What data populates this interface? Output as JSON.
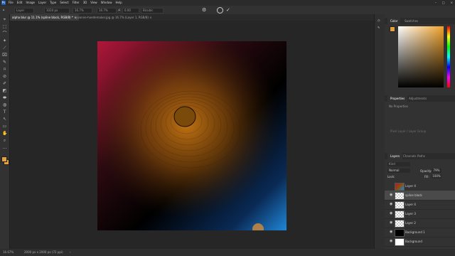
{
  "app": {
    "logo_text": "Ps"
  },
  "menu": [
    "File",
    "Edit",
    "Image",
    "Layer",
    "Type",
    "Select",
    "Filter",
    "3D",
    "View",
    "Window",
    "Help"
  ],
  "window_controls": [
    "–",
    "□",
    "×"
  ],
  "options_bar": {
    "mode": "Layer",
    "width": "1024 px",
    "height_pct": "16.7%",
    "w_pct": "16.7%",
    "x_value": "0.00",
    "angle_label": "∠",
    "interp": "Bicubic"
  },
  "tabs": [
    {
      "label": "alpha blur @ 11.1% (spline black, RGB/8) *",
      "close": "×"
    },
    {
      "label": "yvonne-hoedemaker.jpg @ 16.7% (Layer 1, RGB/8)",
      "close": "×"
    }
  ],
  "tools": [
    "⌖",
    "⬚",
    "⌒",
    "✦",
    "⟋",
    "⌧",
    "✎",
    "⌑",
    "⊘",
    "✐",
    "◩",
    "⬬",
    "◍",
    "T",
    "↖",
    "▭",
    "✋",
    "⌕",
    "…"
  ],
  "colors": {
    "foreground": "#e4a03a",
    "background": "#e4a03a"
  },
  "canvas": {
    "image": "alpha blur artwork"
  },
  "color_panel": {
    "tabs": [
      "Color",
      "Swatches"
    ]
  },
  "properties_panel": {
    "tabs": [
      "Properties",
      "Adjustments"
    ],
    "empty_text": "No Properties",
    "hint_text": "Pixel Layer / Layer Group"
  },
  "layers_panel": {
    "tabs": [
      "Layers",
      "Channels",
      "Paths"
    ],
    "kind_label": "Kind",
    "blend_mode": "Normal",
    "opacity_label": "Opacity:",
    "opacity_value": "79%",
    "lock_label": "Lock:",
    "fill_label": "Fill:",
    "fill_value": "100%",
    "layers": [
      {
        "name": "Layer 4",
        "visible": false,
        "thumb": "art"
      },
      {
        "name": "spline black",
        "visible": true,
        "thumb": "checker"
      },
      {
        "name": "Layer 4",
        "visible": true,
        "thumb": "checker"
      },
      {
        "name": "Layer 3",
        "visible": true,
        "thumb": "checker"
      },
      {
        "name": "Layer 2",
        "visible": true,
        "thumb": "checker"
      },
      {
        "name": "Background 1",
        "visible": true,
        "thumb": "black"
      },
      {
        "name": "Background",
        "visible": true,
        "thumb": "white"
      }
    ]
  },
  "status": {
    "zoom": "16.67%",
    "doc_size": "2000 px x 2000 px (72 ppi)",
    "arrow": "›"
  }
}
